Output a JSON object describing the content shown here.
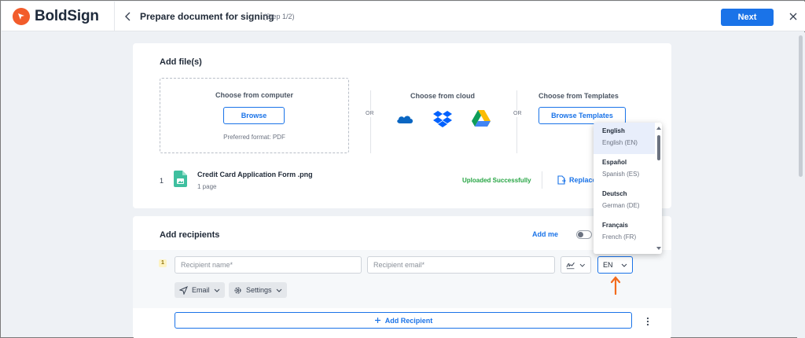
{
  "header": {
    "brand": "BoldSign",
    "title": "Prepare document for signing",
    "step": "(Step 1/2)",
    "next_label": "Next"
  },
  "files": {
    "title": "Add file(s)",
    "computer": {
      "title": "Choose from computer",
      "button": "Browse",
      "format": "Preferred format: PDF"
    },
    "or_label": "OR",
    "cloud": {
      "title": "Choose from cloud",
      "icons": [
        "onedrive-icon",
        "dropbox-icon",
        "google-drive-icon"
      ]
    },
    "templates": {
      "title": "Choose from Templates",
      "button": "Browse Templates"
    },
    "uploaded": [
      {
        "index": "1",
        "name": "Credit Card Application Form .png",
        "pages": "1 page",
        "status": "Uploaded Successfully",
        "action": "Replace"
      }
    ]
  },
  "recipients": {
    "title": "Add recipients",
    "add_me": "Add me",
    "rows": [
      {
        "index": "1",
        "name_placeholder": "Recipient name*",
        "email_placeholder": "Recipient email*",
        "language": "EN",
        "delivery": "Email",
        "settings": "Settings"
      }
    ],
    "add_button": "Add Recipient"
  },
  "language_dropdown": {
    "options": [
      {
        "name": "English",
        "sub": "English (EN)",
        "selected": true
      },
      {
        "name": "Español",
        "sub": "Spanish (ES)"
      },
      {
        "name": "Deutsch",
        "sub": "German (DE)"
      },
      {
        "name": "Français",
        "sub": "French (FR)"
      }
    ]
  },
  "colors": {
    "brand": "#f25c2b",
    "primary": "#1a73e8",
    "success": "#27a544",
    "annotation_arrow": "#f26b1d"
  }
}
